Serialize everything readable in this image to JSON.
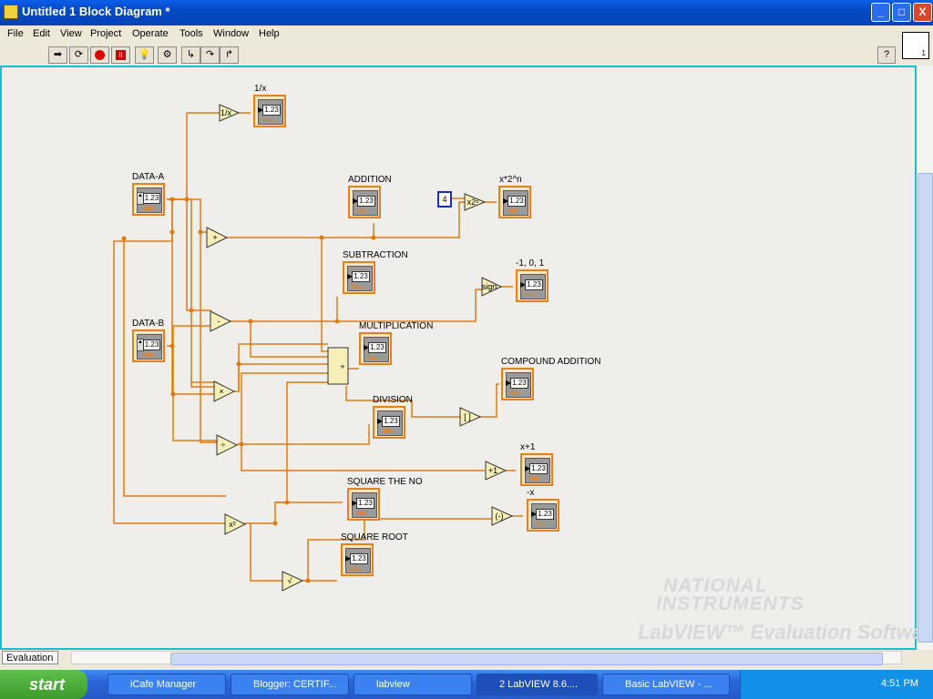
{
  "window": {
    "title": "Untitled 1 Block Diagram *",
    "buttons": [
      "_",
      "□",
      "X"
    ]
  },
  "menu": [
    "File",
    "Edit",
    "View",
    "Project",
    "Operate",
    "Tools",
    "Window",
    "Help"
  ],
  "toolbar": {
    "icons": [
      "run-arrow-icon",
      "run-continuously-icon",
      "abort-icon",
      "pause-icon",
      "highlight-execution-icon",
      "retain-wire-values-icon",
      "step-into-icon",
      "step-over-icon",
      "step-out-icon"
    ],
    "help_label": "?",
    "vi_icon_number": "1"
  },
  "diagram": {
    "controls": [
      {
        "label": "DATA-A",
        "value": "1.23",
        "type": "DBL"
      },
      {
        "label": "DATA-B",
        "value": "1.23",
        "type": "DBL"
      }
    ],
    "indicators": [
      {
        "label": "1/x",
        "value": "1.23",
        "type": "DBL"
      },
      {
        "label": "ADDITION",
        "value": "1.23",
        "type": "DBL"
      },
      {
        "label": "x*2^n",
        "value": "1.23",
        "type": "DBL"
      },
      {
        "label": "SUBTRACTION",
        "value": "1.23",
        "type": "DBL"
      },
      {
        "label": "-1, 0, 1",
        "value": "1.23",
        "type": "DBL"
      },
      {
        "label": "MULTIPLICATION",
        "value": "1.23",
        "type": "DBL"
      },
      {
        "label": "COMPOUND ADDITION",
        "value": "1.23",
        "type": "DBL"
      },
      {
        "label": "DIVISION",
        "value": "1.23",
        "type": "DBL"
      },
      {
        "label": "x+1",
        "value": "1.23",
        "type": "DBL"
      },
      {
        "label": "SQUARE THE NO",
        "value": "1.23",
        "type": "DBL"
      },
      {
        "label": "-x",
        "value": "1.23",
        "type": "DBL"
      },
      {
        "label": "SQUARE ROOT",
        "value": "1.23",
        "type": "DBL"
      }
    ],
    "constant": "4",
    "functions": [
      "1/x",
      "+",
      "-",
      "×",
      "÷",
      "x²",
      "√",
      "x2ⁿ",
      "sign",
      "[ ]",
      "+1",
      "(-)"
    ]
  },
  "watermark": {
    "line1": "NATIONAL",
    "line2": "INSTRUMENTS",
    "line3": "LabVIEW™ Evaluation Software"
  },
  "hscroll": {
    "tab_label": "Evaluation"
  },
  "taskbar": {
    "start_label": "start",
    "tasks": [
      "iCafe Manager",
      "Blogger: CERTIF...",
      "labview",
      "2 LabVIEW 8.6....",
      "Basic LabVIEW - ..."
    ],
    "clock": "4:51 PM"
  }
}
